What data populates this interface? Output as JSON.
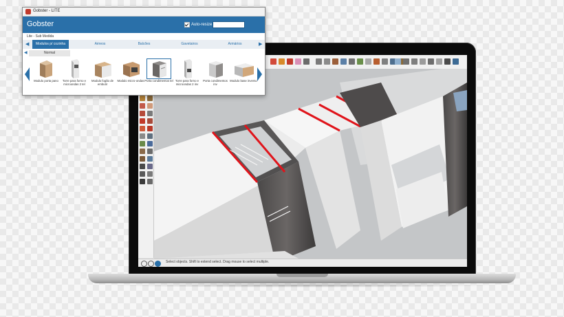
{
  "plugin": {
    "window_title": "Gobster - LITE",
    "logo": "Gobster",
    "autoresize_label": "Auto-resize",
    "autoresize_checked": true,
    "search_value": "",
    "breadcrumb": "Lite - Sub Medida",
    "tabs": [
      {
        "label": "Modulos p/ cozinha",
        "active": true
      },
      {
        "label": "Aéreos",
        "active": false
      },
      {
        "label": "Balcões",
        "active": false
      },
      {
        "label": "Gavetairos",
        "active": false
      },
      {
        "label": "Armários",
        "active": false
      }
    ],
    "subtab": "Normal",
    "items": [
      {
        "label": "Modulo porta pano",
        "selected": false
      },
      {
        "label": "Torre para forno e microondas 2 tel",
        "selected": false
      },
      {
        "label": "Modulo fogão de embutir",
        "selected": false
      },
      {
        "label": "Modulo micro-ondas",
        "selected": false
      },
      {
        "label": "Porta condimentos tel",
        "selected": true
      },
      {
        "label": "Torre para forno e microondas 2 inv",
        "selected": false
      },
      {
        "label": "Porta condimentos inv",
        "selected": false
      },
      {
        "label": "Modulo base inverso",
        "selected": false
      }
    ],
    "accent_color": "#2a70a9"
  },
  "sketchup": {
    "status_text": "Select objects. Shift to extend select. Drag mouse to select multiple.",
    "highlight_color": "#e0141b"
  }
}
